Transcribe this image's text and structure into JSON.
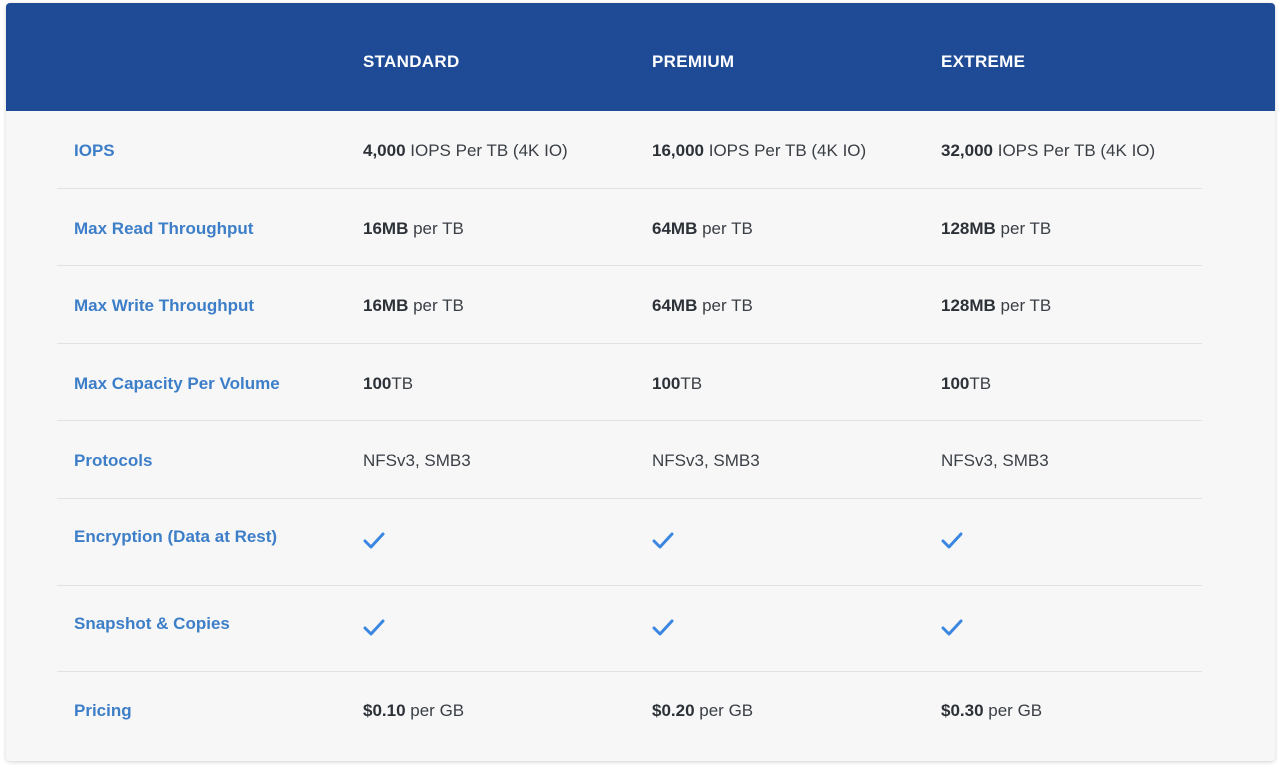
{
  "header": {
    "tiers": [
      "STANDARD",
      "PREMIUM",
      "EXTREME"
    ]
  },
  "rows": [
    {
      "label": "IOPS",
      "cells": [
        {
          "bold": "4,000",
          "rest": " IOPS Per TB (4K IO)"
        },
        {
          "bold": "16,000",
          "rest": " IOPS Per TB (4K IO)"
        },
        {
          "bold": "32,000",
          "rest": " IOPS Per TB (4K IO)"
        }
      ]
    },
    {
      "label": "Max Read Throughput",
      "cells": [
        {
          "bold": "16MB",
          "rest": " per TB"
        },
        {
          "bold": "64MB",
          "rest": " per TB"
        },
        {
          "bold": "128MB",
          "rest": " per TB"
        }
      ]
    },
    {
      "label": "Max Write Throughput",
      "cells": [
        {
          "bold": "16MB",
          "rest": " per TB"
        },
        {
          "bold": "64MB",
          "rest": " per TB"
        },
        {
          "bold": "128MB",
          "rest": " per TB"
        }
      ]
    },
    {
      "label": "Max Capacity Per Volume",
      "cells": [
        {
          "bold": "100",
          "rest": "TB"
        },
        {
          "bold": "100",
          "rest": "TB"
        },
        {
          "bold": "100",
          "rest": "TB"
        }
      ]
    },
    {
      "label": "Protocols",
      "cells": [
        {
          "bold": "",
          "rest": "NFSv3, SMB3"
        },
        {
          "bold": "",
          "rest": "NFSv3, SMB3"
        },
        {
          "bold": "",
          "rest": "NFSv3, SMB3"
        }
      ]
    },
    {
      "label": "Encryption (Data at Rest)",
      "checks": [
        true,
        true,
        true
      ]
    },
    {
      "label": "Snapshot & Copies",
      "checks": [
        true,
        true,
        true
      ]
    },
    {
      "label": "Pricing",
      "cells": [
        {
          "bold": "$0.10",
          "rest": " per GB"
        },
        {
          "bold": "$0.20",
          "rest": " per GB"
        },
        {
          "bold": "$0.30",
          "rest": " per GB"
        }
      ]
    }
  ],
  "icons": {
    "check": "check-icon"
  },
  "colors": {
    "header_bg": "#1f4b96",
    "label_blue": "#3d7ec8",
    "check_blue": "#3a86e0"
  }
}
